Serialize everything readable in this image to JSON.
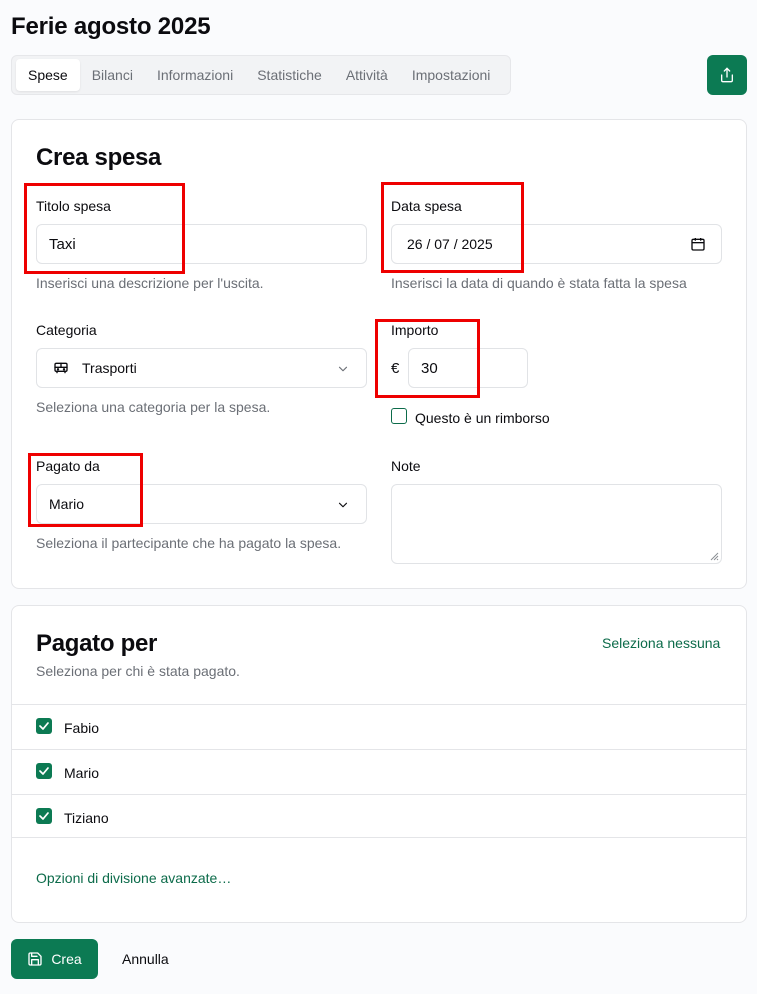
{
  "page": {
    "title": "Ferie agosto 2025"
  },
  "tabs": [
    {
      "label": "Spese",
      "active": true
    },
    {
      "label": "Bilanci",
      "active": false
    },
    {
      "label": "Informazioni",
      "active": false
    },
    {
      "label": "Statistiche",
      "active": false
    },
    {
      "label": "Attività",
      "active": false
    },
    {
      "label": "Impostazioni",
      "active": false
    }
  ],
  "share": {
    "icon": "share-icon"
  },
  "form": {
    "title": "Crea spesa",
    "expense_title": {
      "label": "Titolo spesa",
      "value": "Taxi",
      "help": "Inserisci una descrizione per l'uscita."
    },
    "expense_date": {
      "label": "Data spesa",
      "value": "26 / 07 / 2025",
      "help": "Inserisci la data di quando è stata fatta la spesa"
    },
    "category": {
      "label": "Categoria",
      "value": "Trasporti",
      "icon": "bus-icon",
      "help": "Seleziona una categoria per la spesa."
    },
    "amount": {
      "label": "Importo",
      "currency": "€",
      "value": "30"
    },
    "refund": {
      "label": "Questo è un rimborso",
      "checked": false
    },
    "paid_by": {
      "label": "Pagato da",
      "value": "Mario",
      "help": "Seleziona il partecipante che ha pagato la spesa."
    },
    "notes": {
      "label": "Note",
      "value": ""
    }
  },
  "paid_for": {
    "title": "Pagato per",
    "subtitle": "Seleziona per chi è stata pagato.",
    "select_none": "Seleziona nessuna",
    "participants": [
      {
        "name": "Fabio",
        "checked": true
      },
      {
        "name": "Mario",
        "checked": true
      },
      {
        "name": "Tiziano",
        "checked": true
      }
    ],
    "advanced_link": "Opzioni di divisione avanzate…"
  },
  "actions": {
    "create_label": "Crea",
    "cancel_label": "Annulla"
  },
  "colors": {
    "accent": "#0c7a53",
    "highlight": "#ee0000"
  }
}
